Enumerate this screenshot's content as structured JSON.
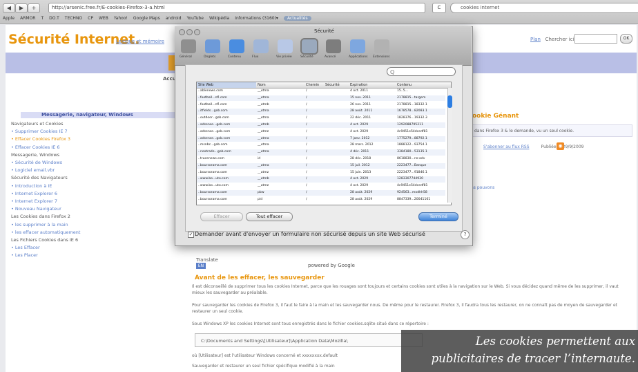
{
  "browser": {
    "url": "http://arsenic.free.fr/E-cookies-Firefox-3-a.html",
    "reload_label": "C",
    "search_text": "cookies internet",
    "bookmarks": [
      "Apple",
      "ARMOR",
      "T",
      "DO.T",
      "TECHNO",
      "CP",
      "WEB",
      "Yahoo!",
      "Google Maps",
      "android",
      "YouTube",
      "Wikipédia",
      "Informations (3160)▾",
      "Actualités"
    ]
  },
  "site": {
    "title": "Sécurité Internet.",
    "subtitle": "Lexique et mémoire",
    "top_links": {
      "plan": "Plan",
      "search_label": "Chercher ici :",
      "go": "OK"
    },
    "accueil": "Accueil",
    "sidebar": {
      "title": "Messagerie, navigateur, Windows",
      "items": [
        {
          "label": "Navigateurs et Cookies",
          "kind": "head"
        },
        {
          "label": "• Supprimer Cookies IE 7",
          "kind": "link"
        },
        {
          "label": "• Effacer Cookies Firefox 3",
          "kind": "hot"
        },
        {
          "label": "• Effacer Cookies IE 6",
          "kind": "link"
        },
        {
          "label": "Messagerie, Windows",
          "kind": "head"
        },
        {
          "label": "• Sécurité de Windows",
          "kind": "link"
        },
        {
          "label": "• Logiciel email.vbr",
          "kind": "link"
        },
        {
          "label": "Sécurité des Navigateurs",
          "kind": "head"
        },
        {
          "label": "• Introduction à IE",
          "kind": "link"
        },
        {
          "label": "• Internet Explorer 6",
          "kind": "link"
        },
        {
          "label": "• Internet Explorer 7",
          "kind": "link"
        },
        {
          "label": "• Nouveau Navigateur",
          "kind": "link"
        },
        {
          "label": "Les Cookies dans Firefox 2",
          "kind": "head"
        },
        {
          "label": "• les supprimer à la main",
          "kind": "link"
        },
        {
          "label": "• les effacer automatiquement",
          "kind": "link"
        },
        {
          "label": "Les Fichiers Cookies dans IE 6",
          "kind": "head"
        },
        {
          "label": "• Les Effacer",
          "kind": "link"
        },
        {
          "label": "• Les Placer",
          "kind": "link"
        }
      ]
    },
    "right": {
      "title": "ookie Génant",
      "box": "dans Firefox 3 & le demande, vu un seul cookie.",
      "meta_link": "S'abonner au flux RSS",
      "meta_date": "Publiée le 29/9/2009",
      "extra_link": "ns pouvons"
    },
    "translate": {
      "label": "Translate",
      "button": "EN",
      "brand": "powered by Google"
    },
    "section_title": "Avant de les effacer, les sauvegarder",
    "paragraphs": [
      "Il est déconseillé de supprimer tous les cookies Internet, parce que les rouages sont toujours et certains cookies sont utiles à la navigation sur le Web. Si vous décidez quand même de les supprimer, il vaut mieux les sauvegarder au préalable.",
      "Pour sauvegarder les cookies de Firefox 3, il faut le faire à la main et les sauvegarder nous. De même pour le restaurer. Firefox 3, il faudra tous les restaurer, on ne connaît pas de moyen de sauvegarder et restaurer un seul cookie.",
      "Sous Windows XP les cookies Internet sont tous enregistrés dans le fichier cookies.sqlite situé dans ce répertoire :"
    ],
    "path": "C:\\Documents and Settings\\[Utilisateur]\\Application Data\\Mozilla\\",
    "path_note": "où [Utilisateur] est l'utilisateur Windows concerné et xxxxxxxx.default",
    "path_note2": "Sauvegarder et restaurer un seul fichier spécifique modifié à la main"
  },
  "dialog": {
    "title": "Sécurité",
    "toolbar": [
      {
        "label": "Général",
        "icon": "general-icon",
        "color": "#8f8f8f"
      },
      {
        "label": "Onglets",
        "icon": "tabs-icon",
        "color": "#6d9ad9"
      },
      {
        "label": "Contenu",
        "icon": "content-icon",
        "color": "#4a8de0"
      },
      {
        "label": "Flux",
        "icon": "feeds-icon",
        "color": "#a0b6d8"
      },
      {
        "label": "Vie privée",
        "icon": "privacy-icon",
        "color": "#b8c8e6"
      },
      {
        "label": "Sécurité",
        "icon": "security-icon",
        "color": "#9aa9bd"
      },
      {
        "label": "Avancé",
        "icon": "advanced-icon",
        "color": "#7d7d7d"
      },
      {
        "label": "Applications",
        "icon": "applications-icon",
        "color": "#7ea7df"
      },
      {
        "label": "Extensions",
        "icon": "extensions-icon",
        "color": "#b2b2b2"
      }
    ],
    "filter_placeholder": "Q",
    "columns": [
      "Site Web",
      "Nom",
      "Chemin",
      "Sécurité",
      "Expiration",
      "Contenu"
    ],
    "rows": [
      [
        "..ablenews.com",
        "__utma",
        "/",
        "",
        "4 oct. 2011",
        "15..5..."
      ],
      [
        "..football...nfl.com",
        "__utma",
        "/",
        "",
        "15 nov. 2011",
        "2178815...targem"
      ],
      [
        "..football...nfl.com",
        "__utmb",
        "/",
        "",
        "26 nov. 2011",
        "2178815...18332.1"
      ],
      [
        "..itfields...gob.com",
        "__utma",
        "/",
        "",
        "28 août. 2011",
        "1678578...82083.1"
      ],
      [
        "..outdoor...gob.com",
        "__utma",
        "/",
        "",
        "22 déc. 2011",
        "1828376...19332.3"
      ],
      [
        "..adsense...gob.com",
        "__utmb",
        "/",
        "",
        "4 oct. 2029",
        "1292088795211"
      ],
      [
        "..adsense...gob.com",
        "__utmz",
        "/",
        "",
        "4 oct. 2029",
        "4c9451e54dcedf81"
      ],
      [
        "..adsense...gob.com",
        "__utma",
        "/",
        "",
        "7 janv. 2012",
        "1775279...88792.1"
      ],
      [
        "..msnbc...gob.com",
        "__utma",
        "/",
        "",
        "28 mars. 2012",
        "1888122...93754.1"
      ],
      [
        "..nextrade...gob.com",
        "__utma",
        "/",
        "",
        "4 déc. 2011",
        "3384180...53135.1"
      ],
      [
        "..trucenews.com",
        "id",
        "/",
        "",
        "28 déc. 2018",
        "8618830...rsr.adv"
      ],
      [
        "..boursorama.com",
        "__utma",
        "/",
        "",
        "15 juil. 2012",
        "2223477...Banque"
      ],
      [
        "..boursorama.com",
        "__utmz",
        "/",
        "",
        "15 juin. 2013",
        "2223477...91846.1"
      ],
      [
        "..www.bo...uto.com",
        "__utmb",
        "/",
        "",
        "4 oct. 2029",
        "1283307744930"
      ],
      [
        "..www.bo...uto.com",
        "__utmz",
        "/",
        "",
        "4 oct. 2029",
        "4c9451e54dcedf81"
      ],
      [
        "..boursorama.com",
        "pbw",
        "/",
        "",
        "28 août. 2029",
        "924563...modhh58"
      ],
      [
        "..boursorama.com",
        "pid",
        "/",
        "",
        "28 août. 2029",
        "8847339...20041161"
      ]
    ],
    "buttons": {
      "delete": "Effacer",
      "delete_all": "Tout effacer",
      "close": "Terminé"
    },
    "checkbox_label": "Demander avant d'envoyer un formulaire non sécurisé depuis un site Web sécurisé",
    "checkbox_checked": true,
    "help": "?"
  },
  "caption": {
    "line1": "Les cookies permettent aux",
    "line2": "publicitaires de tracer l’internaute."
  }
}
